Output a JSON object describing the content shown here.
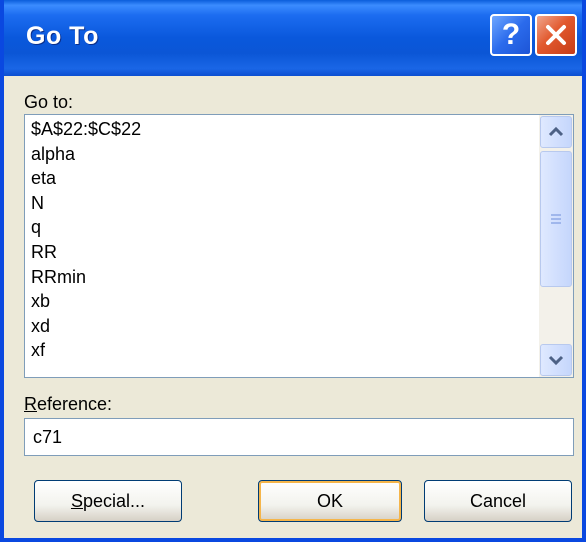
{
  "dialog": {
    "title": "Go To",
    "help_icon": "help-icon",
    "close_icon": "close-icon",
    "goto_label": "Go to:",
    "list_items": [
      "$A$22:$C$22",
      "alpha",
      "eta",
      "N",
      "q",
      "RR",
      "RRmin",
      "xb",
      "xd",
      "xf"
    ],
    "reference_label_underlined": "R",
    "reference_label_rest": "eference:",
    "reference_value": "c71",
    "buttons": {
      "special_underlined": "S",
      "special_rest": "pecial...",
      "ok": "OK",
      "cancel": "Cancel"
    },
    "colors": {
      "titlebar": "#0a58dc",
      "frame": "#0a48e0",
      "dialog_bg": "#ece9d8",
      "close_button": "#e2592e",
      "help_button": "#2b6bec"
    }
  }
}
